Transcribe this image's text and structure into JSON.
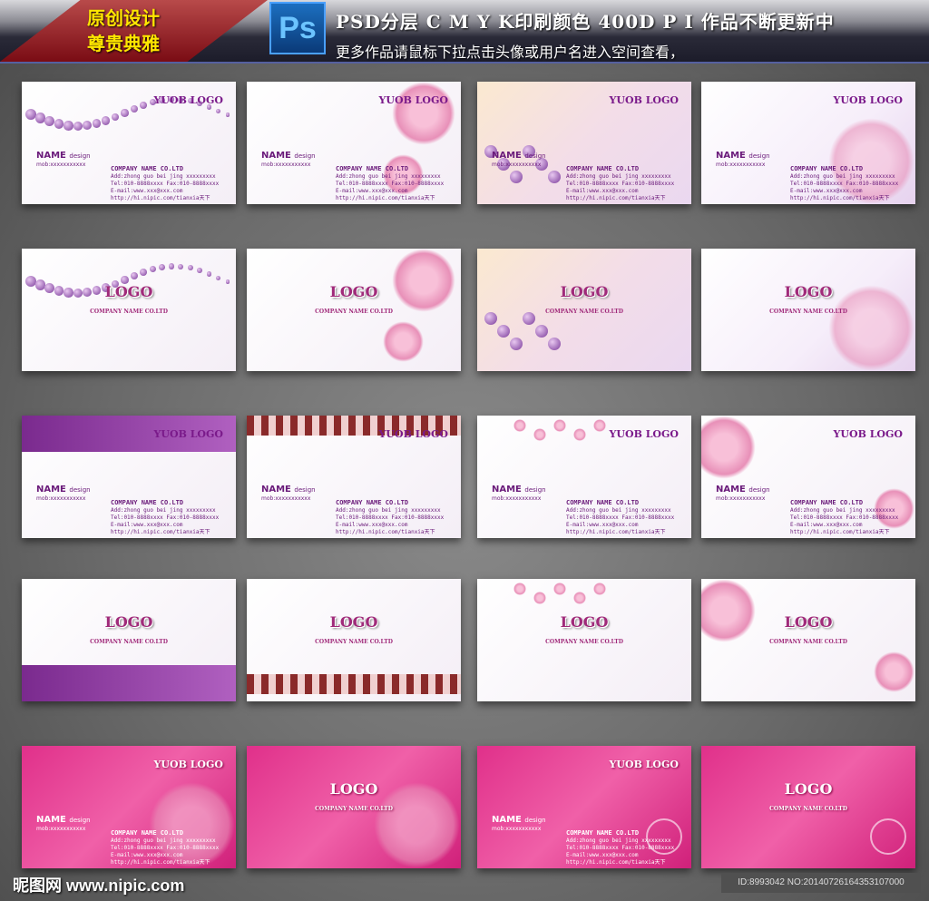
{
  "header": {
    "badge_line1": "原创设计",
    "badge_line2": "尊贵典雅",
    "ps_icon": "Ps",
    "line1": "PSD分层  C M Y K印刷颜色   400D P I  作品不断更新中",
    "line2": "更多作品请鼠标下拉点击头像或用户名进入空间查看，"
  },
  "card_front": {
    "logo": "YUOB LOGO",
    "name": "NAME",
    "name_suffix": "design",
    "mob": "mob:xxxxxxxxxxx",
    "company": "COMPANY NAME CO.LTD",
    "address": "Add:zhong guo bei jing xxxxxxxxx",
    "tel": "Tel:010-8888xxxx Fax:010-8888xxxx",
    "email": "E-mail:www.xxx@xxx.com",
    "url": "http://hi.nipic.com/tianxia天下"
  },
  "card_back": {
    "logo": "LOGO",
    "company": "COMPANY NAME CO.LTD"
  },
  "cards": [
    {
      "side": "front",
      "theme": "w",
      "deco": "pearls"
    },
    {
      "side": "front",
      "theme": "w",
      "deco": "flower"
    },
    {
      "side": "front",
      "theme": "peach",
      "deco": "violets"
    },
    {
      "side": "front",
      "theme": "lav",
      "deco": "lace"
    },
    {
      "side": "back",
      "theme": "w",
      "deco": "pearls"
    },
    {
      "side": "back",
      "theme": "w",
      "deco": "flower"
    },
    {
      "side": "back",
      "theme": "peach",
      "deco": "violets"
    },
    {
      "side": "back",
      "theme": "lav",
      "deco": "lace"
    },
    {
      "side": "front",
      "theme": "w",
      "deco": "purple-band"
    },
    {
      "side": "front",
      "theme": "w",
      "deco": "border-band"
    },
    {
      "side": "front",
      "theme": "w",
      "deco": "bokeh"
    },
    {
      "side": "front",
      "theme": "w",
      "deco": "vine"
    },
    {
      "side": "back",
      "theme": "w",
      "deco": "purple-band"
    },
    {
      "side": "back",
      "theme": "w",
      "deco": "border-band"
    },
    {
      "side": "back",
      "theme": "w",
      "deco": "bokeh"
    },
    {
      "side": "back",
      "theme": "w",
      "deco": "vine"
    },
    {
      "side": "front",
      "theme": "pink",
      "deco": "sparkle"
    },
    {
      "side": "back",
      "theme": "pink",
      "deco": "sparkle"
    },
    {
      "side": "front",
      "theme": "pink",
      "deco": "swirl"
    },
    {
      "side": "back",
      "theme": "pink",
      "deco": "swirl"
    }
  ],
  "footer": {
    "watermark": "昵图网 www.nipic.com",
    "id_text": "ID:8993042 NO:20140726164353107000"
  }
}
